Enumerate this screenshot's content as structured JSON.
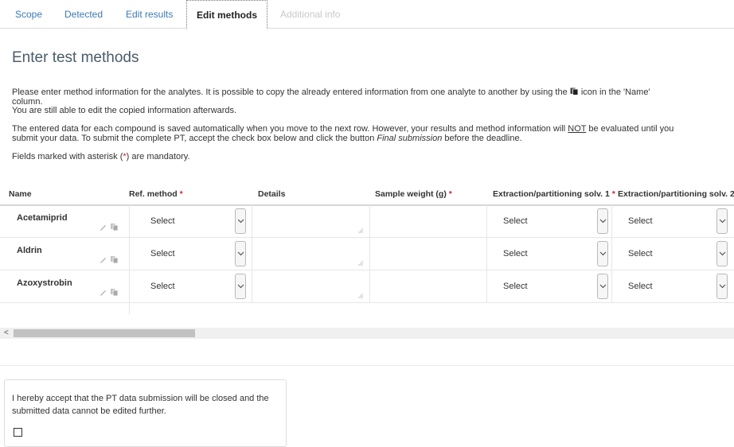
{
  "tabs": [
    {
      "label": "Scope"
    },
    {
      "label": "Detected"
    },
    {
      "label": "Edit results"
    },
    {
      "label": "Edit methods"
    },
    {
      "label": "Additional info"
    }
  ],
  "title": "Enter test methods",
  "intro": {
    "line1": "Please enter method information for the analytes. It is possible to copy the already entered information from one analyte to another by using the",
    "line1_after": "icon in the 'Name'",
    "line2": "column.",
    "line3": "You are still able to edit the copied information afterwards.",
    "save_line1_pre": "The entered data for each compound is saved automatically when you move to the next row. However, your results and method information will",
    "save_not": "NOT",
    "save_line1_post": "be evaluated until you",
    "save_line2_pre": "submit your data. To submit the complete PT, accept the check box below and click the button",
    "save_final": "Final submission",
    "save_line2_post": "before the deadline.",
    "mandatory_pre": "Fields marked with asterisk (",
    "mandatory_star": "*",
    "mandatory_post": ") are mandatory."
  },
  "table": {
    "headers": {
      "name": "Name",
      "ref_method": "Ref. method",
      "details": "Details",
      "sample_weight": "Sample weight (g)",
      "extraction1": "Extraction/partitioning solv. 1",
      "extraction2": "Extraction/partitioning solv. 2",
      "required_mark": "*"
    },
    "rows": [
      {
        "name": "Acetamiprid",
        "ref_method": "Select",
        "extraction1": "Select",
        "extraction2": "Select"
      },
      {
        "name": "Aldrin",
        "ref_method": "Select",
        "extraction1": "Select",
        "extraction2": "Select"
      },
      {
        "name": "Azoxystrobin",
        "ref_method": "Select",
        "extraction1": "Select",
        "extraction2": "Select"
      }
    ]
  },
  "scrollbar": {
    "left_arrow": "<"
  },
  "accept": {
    "text": "I hereby accept that the PT data submission will be closed and the submitted data cannot be edited further.",
    "checked": false
  },
  "colors": {
    "link": "#3c7ab5",
    "required": "#d9232d",
    "title": "#4a5c6a"
  },
  "icons": {
    "edit": "pencil-icon",
    "copy": "copy-icon",
    "dropdown": "chevron-down-icon"
  }
}
